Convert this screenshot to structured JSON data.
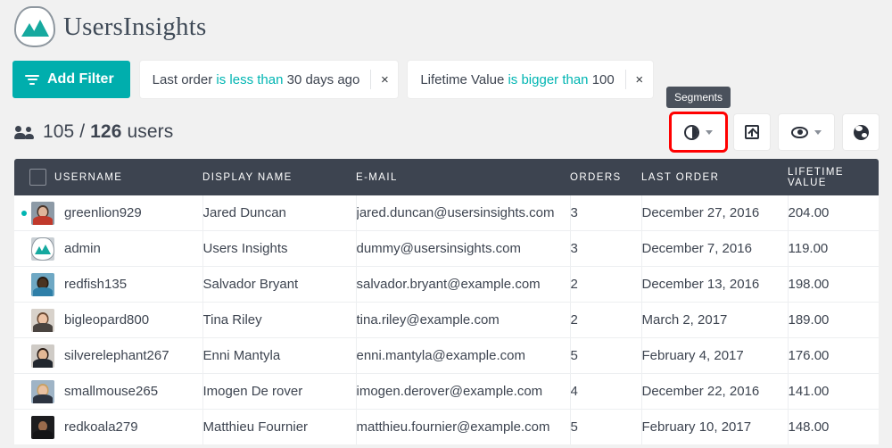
{
  "brand": {
    "name": "UsersInsights",
    "logo_icon": "mountain-logo-icon"
  },
  "filter_bar": {
    "add_filter_label": "Add Filter",
    "add_filter_icon": "funnel-icon",
    "accent_color": "#00aead",
    "operator_color": "#00b5b2",
    "chips": [
      {
        "field": "Last order",
        "operator": "is less than",
        "value": "30 days ago",
        "close_label": "×"
      },
      {
        "field": "Lifetime Value",
        "operator": "is bigger than",
        "value": "100",
        "close_label": "×"
      }
    ]
  },
  "summary": {
    "icon": "users-icon",
    "filtered_count": "105",
    "separator": "/",
    "total_count": "126",
    "unit": "users"
  },
  "toolbar": {
    "tooltip": "Segments",
    "highlight_color": "#ff0000",
    "buttons": [
      {
        "name": "segments-button",
        "icon": "pie-chart-icon",
        "has_caret": true,
        "highlighted": true
      },
      {
        "name": "export-button",
        "icon": "export-icon",
        "has_caret": false,
        "highlighted": false
      },
      {
        "name": "visible-columns-button",
        "icon": "eye-icon",
        "has_caret": true,
        "highlighted": false
      },
      {
        "name": "geo-map-button",
        "icon": "globe-icon",
        "has_caret": false,
        "highlighted": false
      }
    ]
  },
  "table": {
    "header_bg": "#3d4450",
    "select_all_checked": false,
    "columns": [
      {
        "key": "username",
        "label": "USERNAME"
      },
      {
        "key": "display_name",
        "label": "DISPLAY NAME"
      },
      {
        "key": "email",
        "label": "E-MAIL"
      },
      {
        "key": "orders",
        "label": "ORDERS"
      },
      {
        "key": "last_order",
        "label": "LAST ORDER"
      },
      {
        "key": "lifetime_value",
        "label": "LIFETIME VALUE"
      }
    ],
    "rows": [
      {
        "online": true,
        "avatar": "photo-male-glasses",
        "username": "greenlion929",
        "display_name": "Jared Duncan",
        "email": "jared.duncan@usersinsights.com",
        "orders": "3",
        "last_order": "December 27, 2016",
        "lifetime_value": "204.00"
      },
      {
        "online": false,
        "avatar": "brand-logo",
        "username": "admin",
        "display_name": "Users Insights",
        "email": "dummy@usersinsights.com",
        "orders": "3",
        "last_order": "December 7, 2016",
        "lifetime_value": "119.00"
      },
      {
        "online": false,
        "avatar": "photo-male-outdoor",
        "username": "redfish135",
        "display_name": "Salvador Bryant",
        "email": "salvador.bryant@example.com",
        "orders": "2",
        "last_order": "December 13, 2016",
        "lifetime_value": "198.00"
      },
      {
        "online": false,
        "avatar": "photo-female-curly",
        "username": "bigleopard800",
        "display_name": "Tina Riley",
        "email": "tina.riley@example.com",
        "orders": "2",
        "last_order": "March 2, 2017",
        "lifetime_value": "189.00"
      },
      {
        "online": false,
        "avatar": "photo-female-dark",
        "username": "silverelephant267",
        "display_name": "Enni Mantyla",
        "email": "enni.mantyla@example.com",
        "orders": "5",
        "last_order": "February 4, 2017",
        "lifetime_value": "176.00"
      },
      {
        "online": false,
        "avatar": "photo-female-blonde",
        "username": "smallmouse265",
        "display_name": "Imogen De rover",
        "email": "imogen.derover@example.com",
        "orders": "4",
        "last_order": "December 22, 2016",
        "lifetime_value": "141.00"
      },
      {
        "online": false,
        "avatar": "photo-male-bald",
        "username": "redkoala279",
        "display_name": "Matthieu Fournier",
        "email": "matthieu.fournier@example.com",
        "orders": "5",
        "last_order": "February 10, 2017",
        "lifetime_value": "148.00"
      }
    ]
  }
}
